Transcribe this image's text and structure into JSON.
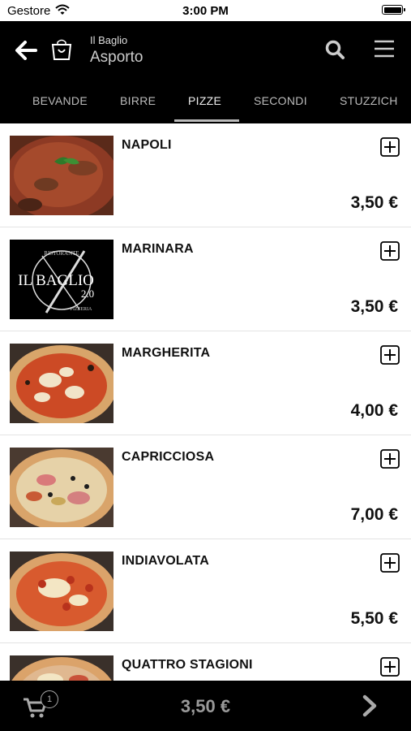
{
  "status": {
    "carrier": "Gestore",
    "time": "3:00 PM"
  },
  "header": {
    "restaurant": "Il Baglio",
    "mode": "Asporto"
  },
  "tabs": [
    {
      "label": "BEVANDE"
    },
    {
      "label": "BIRRE"
    },
    {
      "label": "PIZZE"
    },
    {
      "label": "SECONDI"
    },
    {
      "label": "STUZZICH"
    }
  ],
  "active_tab": "PIZZE",
  "items": [
    {
      "name": "NAPOLI",
      "price": "3,50 €"
    },
    {
      "name": "MARINARA",
      "price": "3,50 €"
    },
    {
      "name": "MARGHERITA",
      "price": "4,00 €"
    },
    {
      "name": "CAPRICCIOSA",
      "price": "7,00 €"
    },
    {
      "name": "INDIAVOLATA",
      "price": "5,50 €"
    },
    {
      "name": "QUATTRO STAGIONI",
      "price": ""
    }
  ],
  "logo": {
    "line1": "IL BAGLIO",
    "line2": "2.0",
    "top": "RISTORANTE",
    "bottom": "PIZZERIA"
  },
  "cart": {
    "count": "1",
    "total": "3,50 €"
  },
  "colors": {
    "header_bg": "#000000",
    "footer_bg": "#000000",
    "accent": "#ffffff"
  }
}
